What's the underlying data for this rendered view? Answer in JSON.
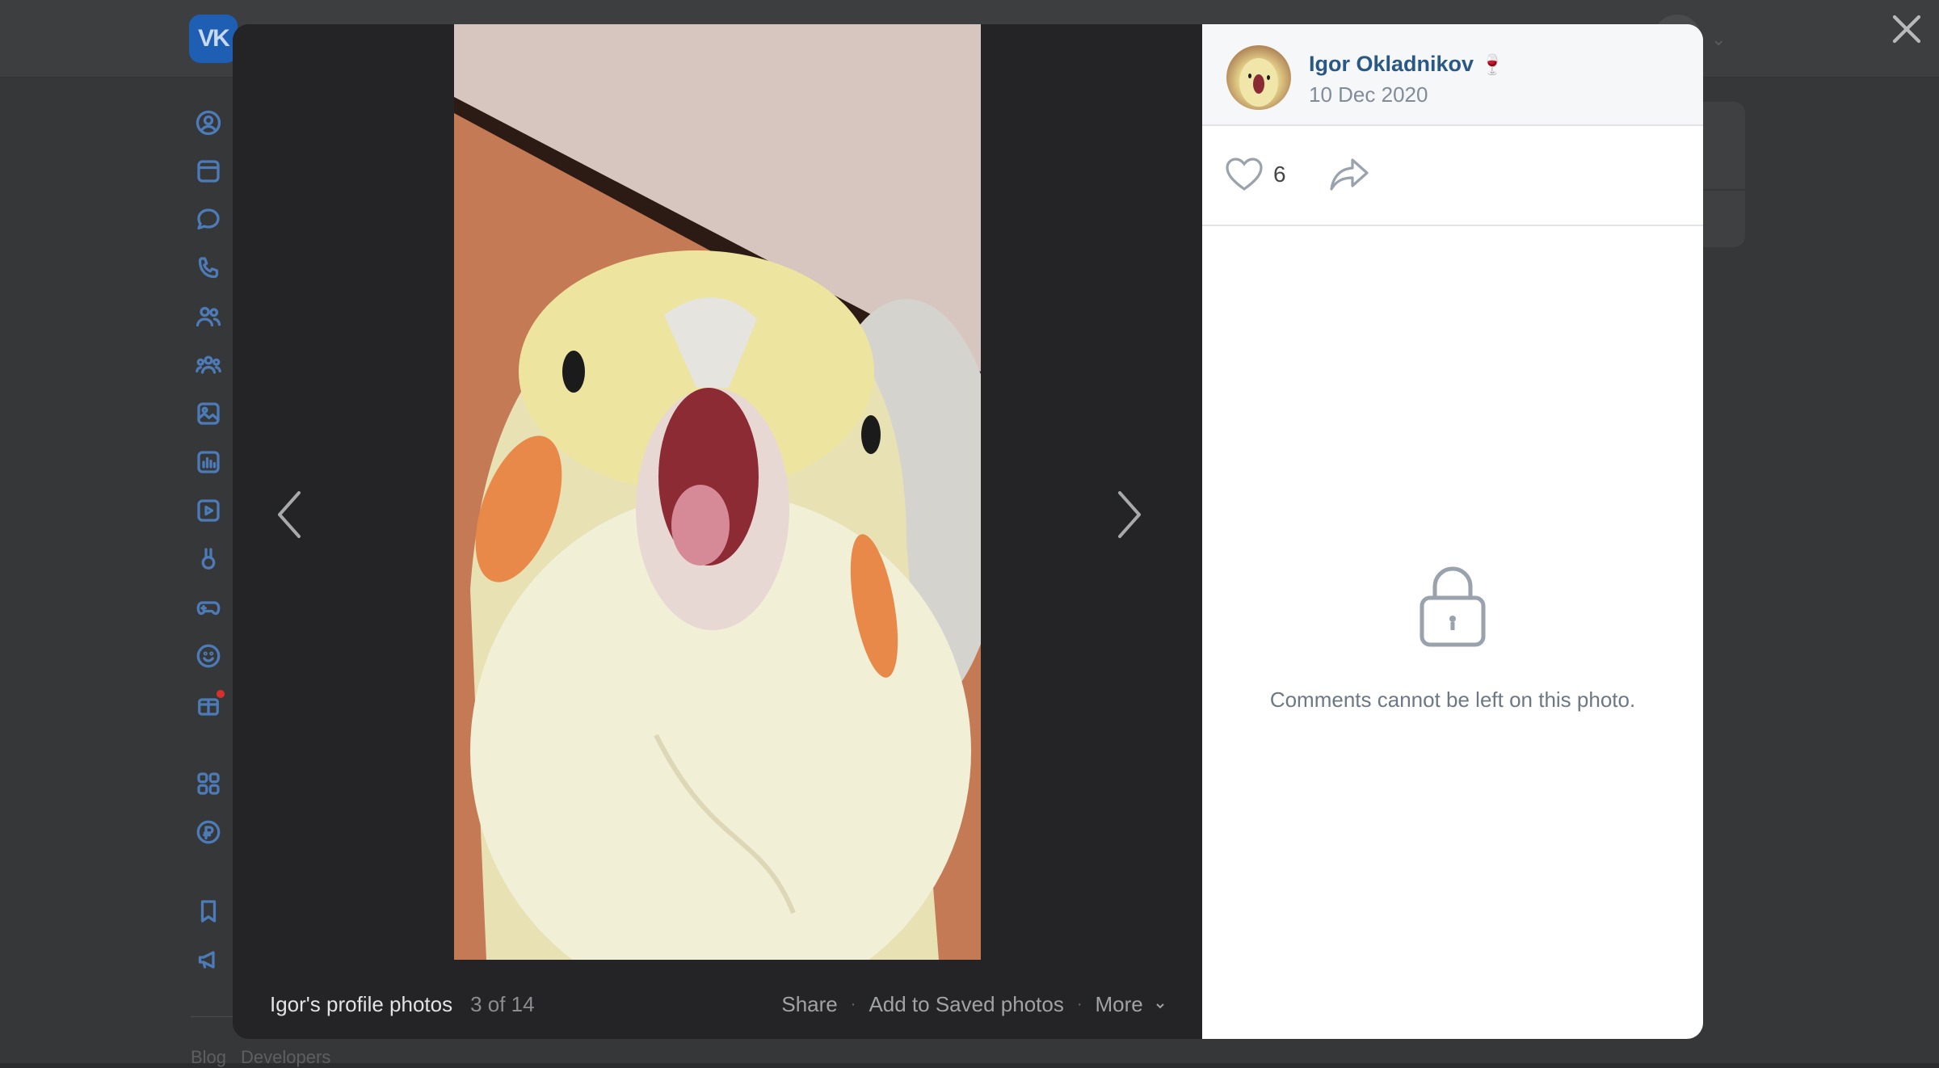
{
  "viewer": {
    "album_title": "Igor's profile photos",
    "counter": "3 of 14",
    "actions": {
      "share": "Share",
      "add_saved": "Add to Saved photos",
      "more": "More"
    },
    "separator": "·"
  },
  "panel": {
    "owner_name": "Igor Okladnikov",
    "owner_emoji": "🍷",
    "date": "10 Dec 2020",
    "likes": "6",
    "comments_notice": "Comments cannot be left on this photo."
  },
  "background": {
    "logo_text": "VK",
    "footer_links": [
      "Blog",
      "Developers"
    ]
  },
  "icons": {
    "sidebar": [
      "profile-icon",
      "news-icon",
      "messages-icon",
      "calls-icon",
      "friends-icon",
      "communities-icon",
      "photos-icon",
      "music-icon",
      "videos-icon",
      "clips-icon",
      "games-icon",
      "stickers-icon",
      "gifts-icon",
      "apps-icon",
      "payments-icon",
      "bookmarks-icon",
      "ads-icon"
    ],
    "photo_prev": "chevron-left-icon",
    "photo_next": "chevron-right-icon",
    "like": "heart-icon",
    "share": "share-arrow-icon",
    "lock": "lock-icon",
    "close": "close-icon"
  },
  "colors": {
    "link": "#2a5885",
    "vk_blue": "#1f5fb3",
    "notice_text": "#6d7885"
  }
}
